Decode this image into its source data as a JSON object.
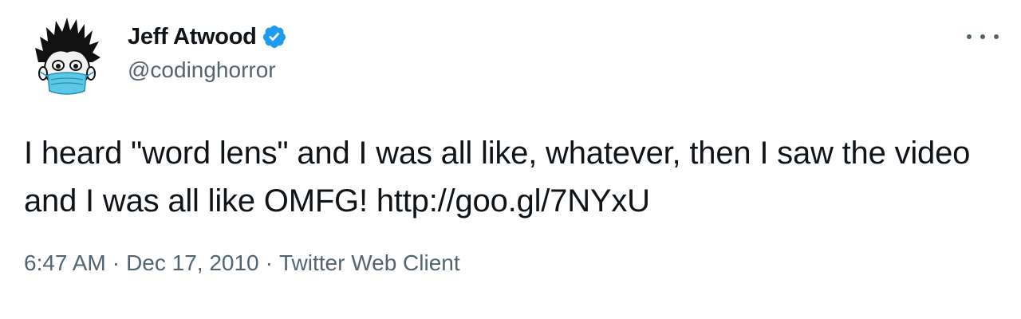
{
  "tweet": {
    "author": {
      "display_name": "Jeff Atwood",
      "handle": "@codinghorror",
      "verified": true,
      "verified_icon": "verified-badge-icon",
      "avatar_icon": "spiky-hair-masked-face-avatar"
    },
    "text_prefix": "I heard \"word lens\" and I was all like, whatever, then I saw the video and I was all like OMFG! ",
    "link": "http://goo.gl/7NYxU",
    "time": "6:47 AM",
    "separator": "·",
    "date": "Dec 17, 2010",
    "source": "Twitter Web Client",
    "more_icon": "more-options-icon"
  },
  "colors": {
    "text_primary": "#0f1419",
    "text_secondary": "#536471",
    "verified_blue": "#1d9bf0",
    "mask_blue": "#5bc8e8"
  }
}
